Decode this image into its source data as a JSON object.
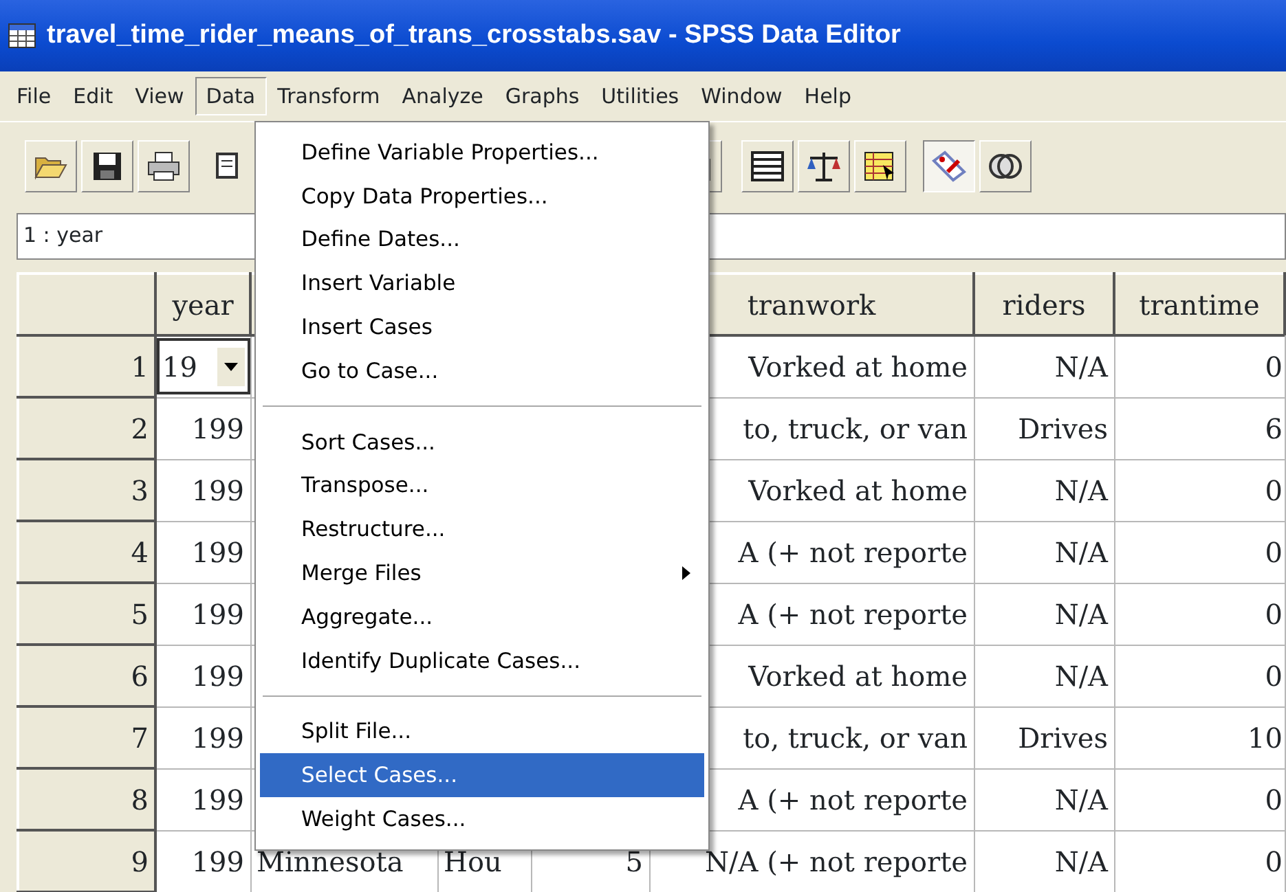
{
  "window": {
    "title": "travel_time_rider_means_of_trans_crosstabs.sav - SPSS Data Editor"
  },
  "menu_bar": [
    {
      "label": "File",
      "selected": false
    },
    {
      "label": "Edit",
      "selected": false
    },
    {
      "label": "View",
      "selected": false
    },
    {
      "label": "Data",
      "selected": true
    },
    {
      "label": "Transform",
      "selected": false
    },
    {
      "label": "Analyze",
      "selected": false
    },
    {
      "label": "Graphs",
      "selected": false
    },
    {
      "label": "Utilities",
      "selected": false
    },
    {
      "label": "Window",
      "selected": false
    },
    {
      "label": "Help",
      "selected": false
    }
  ],
  "data_menu": {
    "items": [
      {
        "kind": "item",
        "label": "Define Variable Properties...",
        "selected": false,
        "submenu": false
      },
      {
        "kind": "item",
        "label": "Copy Data Properties...",
        "selected": false,
        "submenu": false
      },
      {
        "kind": "item",
        "label": "Define Dates...",
        "selected": false,
        "submenu": false
      },
      {
        "kind": "item",
        "label": "Insert Variable",
        "selected": false,
        "submenu": false
      },
      {
        "kind": "item",
        "label": "Insert Cases",
        "selected": false,
        "submenu": false
      },
      {
        "kind": "item",
        "label": "Go to Case...",
        "selected": false,
        "submenu": false
      },
      {
        "kind": "separator"
      },
      {
        "kind": "item",
        "label": "Sort Cases...",
        "selected": false,
        "submenu": false
      },
      {
        "kind": "item",
        "label": "Transpose...",
        "selected": false,
        "submenu": false
      },
      {
        "kind": "item",
        "label": "Restructure...",
        "selected": false,
        "submenu": false
      },
      {
        "kind": "item",
        "label": "Merge Files",
        "selected": false,
        "submenu": true
      },
      {
        "kind": "item",
        "label": "Aggregate...",
        "selected": false,
        "submenu": false
      },
      {
        "kind": "item",
        "label": "Identify Duplicate Cases...",
        "selected": false,
        "submenu": false
      },
      {
        "kind": "separator"
      },
      {
        "kind": "item",
        "label": "Split File...",
        "selected": false,
        "submenu": false
      },
      {
        "kind": "item",
        "label": "Select Cases...",
        "selected": true,
        "submenu": false
      },
      {
        "kind": "item",
        "label": "Weight Cases...",
        "selected": false,
        "submenu": false
      }
    ]
  },
  "cell_reference": "1 : year",
  "grid": {
    "columns": [
      "year",
      null,
      null,
      null,
      "tranwork",
      "riders",
      "trantime"
    ],
    "rows": [
      {
        "number": "1",
        "editing": true,
        "cells": [
          "19",
          null,
          null,
          null,
          "Vorked at home",
          "N/A",
          "0"
        ]
      },
      {
        "number": "2",
        "editing": false,
        "cells": [
          "199",
          null,
          null,
          null,
          "to, truck, or van",
          "Drives",
          "6"
        ]
      },
      {
        "number": "3",
        "editing": false,
        "cells": [
          "199",
          null,
          null,
          null,
          "Vorked at home",
          "N/A",
          "0"
        ]
      },
      {
        "number": "4",
        "editing": false,
        "cells": [
          "199",
          null,
          null,
          null,
          "A (+ not reporte",
          "N/A",
          "0"
        ]
      },
      {
        "number": "5",
        "editing": false,
        "cells": [
          "199",
          null,
          null,
          null,
          "A (+ not reporte",
          "N/A",
          "0"
        ]
      },
      {
        "number": "6",
        "editing": false,
        "cells": [
          "199",
          null,
          null,
          null,
          "Vorked at home",
          "N/A",
          "0"
        ]
      },
      {
        "number": "7",
        "editing": false,
        "cells": [
          "199",
          null,
          null,
          null,
          "to, truck, or van",
          "Drives",
          "10"
        ]
      },
      {
        "number": "8",
        "editing": false,
        "cells": [
          "199",
          null,
          null,
          null,
          "A (+ not reporte",
          "N/A",
          "0"
        ]
      },
      {
        "number": "9",
        "editing": false,
        "cells": [
          "199",
          "Minnesota",
          "Hou",
          "5",
          "N/A (+ not reporte",
          "N/A",
          "0"
        ]
      }
    ]
  }
}
